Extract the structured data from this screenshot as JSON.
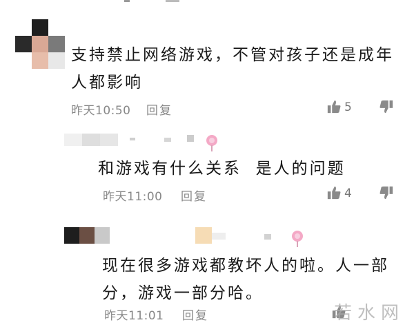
{
  "comments": [
    {
      "text": "支持禁止网络游戏，不管对孩子还是成年\n人都影响",
      "time": "昨天10:50",
      "reply": "回复",
      "likes": "5"
    },
    {
      "text": "和游戏有什么关系  是人的问题",
      "time": "昨天11:00",
      "reply": "回复",
      "likes": "4"
    },
    {
      "text": "现在很多游戏都教坏人的啦。人一部\n分，游戏一部分哈。",
      "time": "昨天11:01",
      "reply": "回复",
      "likes": ""
    }
  ],
  "icons": {
    "like": "thumbs-up-icon",
    "dislike": "thumbs-down-icon",
    "sticker": "lollipop-icon"
  },
  "colors": {
    "text": "#1a1a1a",
    "meta": "#888888",
    "icon": "#8a8a8a"
  },
  "watermark": "若水网"
}
